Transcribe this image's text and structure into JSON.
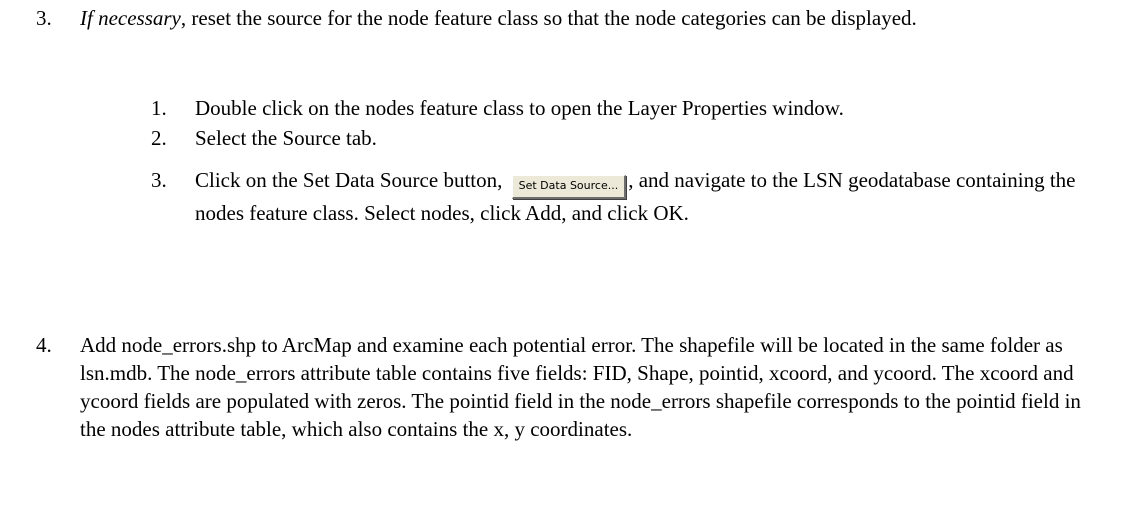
{
  "step3": {
    "number": "3.",
    "emphasis": "If necessary",
    "text": ", reset the source for the node feature class so that the node categories can be displayed.",
    "substeps": [
      {
        "number": "1.",
        "text": "Double click on the nodes feature class to open the Layer Properties window."
      },
      {
        "number": "2.",
        "text": "Select the Source tab."
      },
      {
        "number": "3.",
        "text_before": "Click on the Set Data Source button,",
        "button_label": "Set Data Source...",
        "text_after": ", and navigate to the LSN geodatabase containing the nodes feature class. Select nodes, click Add, and click OK."
      }
    ]
  },
  "step4": {
    "number": "4.",
    "text": "Add node_errors.shp to ArcMap and examine each potential error. The shapefile will be located in the same folder as lsn.mdb. The node_errors attribute table contains five fields: FID, Shape, pointid, xcoord, and ycoord. The xcoord and ycoord fields are populated with zeros. The pointid field in the node_errors shapefile corresponds to the pointid field in the nodes attribute table, which also contains the x, y coordinates."
  }
}
